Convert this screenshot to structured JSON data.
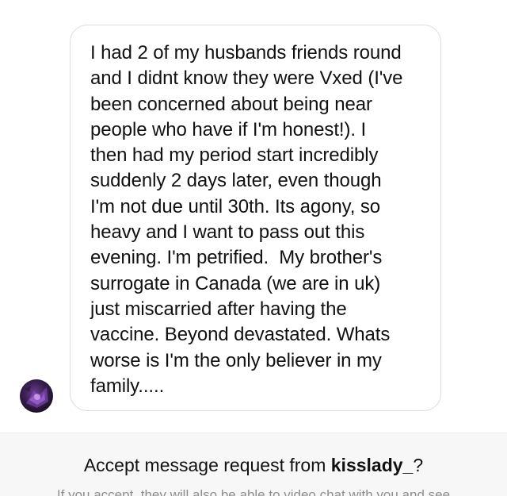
{
  "message": {
    "text": "I had 2 of my husbands friends round\nand I didnt know they were Vxed (I've\nbeen concerned about being near\npeople who have if I'm honest!). I\nthen had my period start incredibly\nsuddenly 2 days later, even though\nI'm not due until 30th. Its agony, so\nheavy and I want to pass out this\nevening. I'm petrified.  My brother's\nsurrogate in Canada (we are in uk)\njust miscarried after having the\nvaccine. Beyond devastated. Whats\nworse is I'm the only believer in my\nfamily.....",
    "sender_avatar_icon": "profile-photo"
  },
  "request_bar": {
    "title_prefix": "Accept message request from ",
    "username": "kisslady_",
    "title_suffix": "?",
    "subtitle": "If you accept, they will also be able to video chat with you and see"
  },
  "colors": {
    "bubble_border": "#dcdcdc",
    "bar_background": "#f7f7f7",
    "subtitle": "#8e8e8e"
  }
}
